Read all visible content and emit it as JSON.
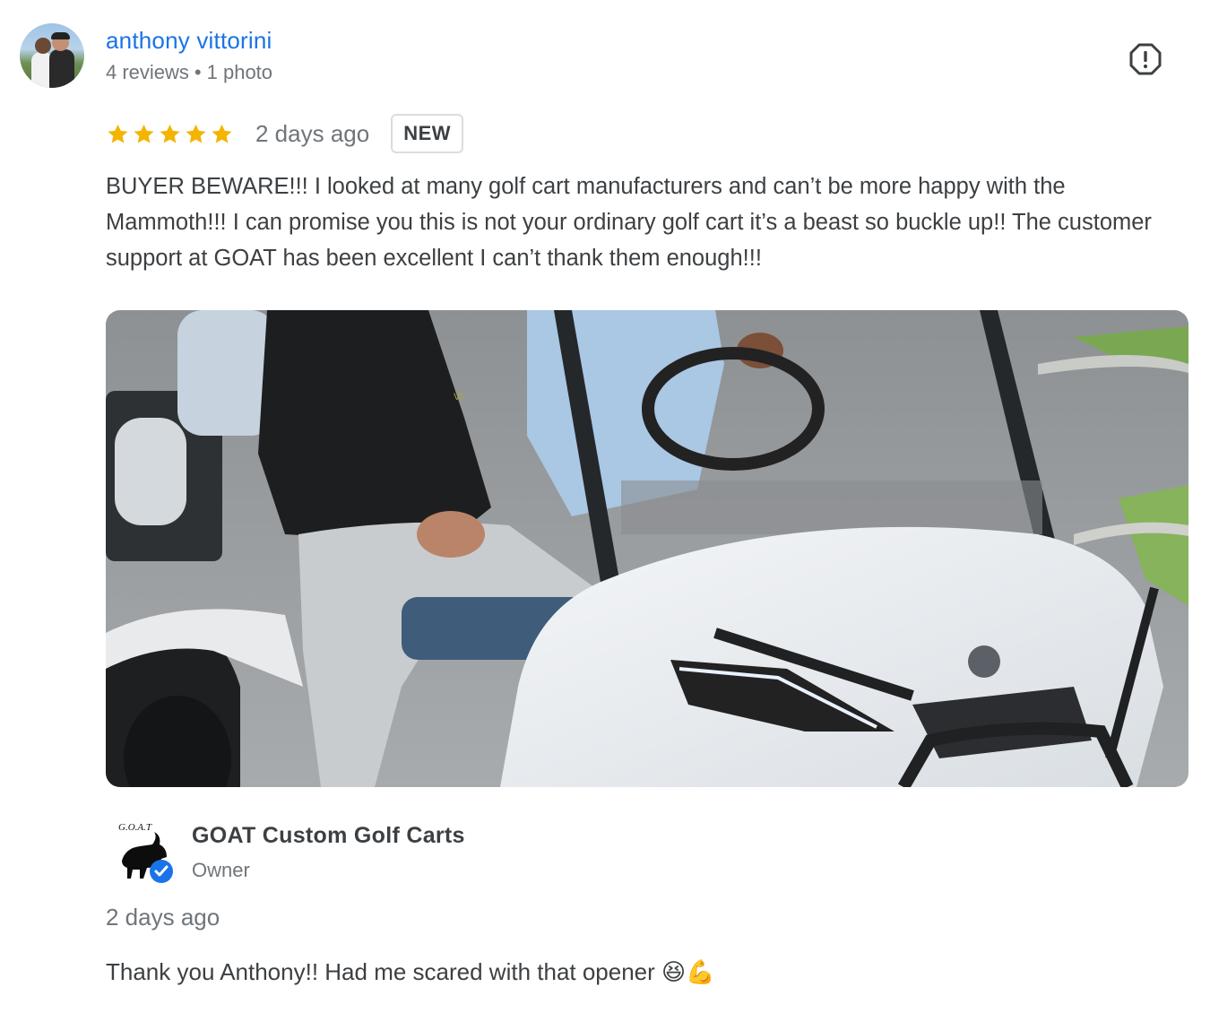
{
  "review": {
    "reviewer_name": "anthony vittorini",
    "reviewer_reviews": "4 reviews",
    "reviewer_dot": "•",
    "reviewer_photos": "1 photo",
    "rating": 5,
    "rating_max": 5,
    "time_ago": "2 days ago",
    "badge": "NEW",
    "text": "BUYER BEWARE!!! I looked at many golf cart manufacturers and can’t be more happy with the Mammoth!!! I can promise you this is not your ordinary golf cart it’s a beast so buckle up!! The customer support at GOAT has been excellent I can’t thank them enough!!!",
    "star_color": "#f4b400",
    "name_color": "#1a73e8"
  },
  "photo": {
    "alt": "Review photo"
  },
  "reply": {
    "owner_name": "GOAT Custom Golf Carts",
    "owner_role": "Owner",
    "time_ago": "2 days ago",
    "text": "Thank you Anthony!! Had me scared with that opener 😆💪",
    "logo_text": "G.O.A.T",
    "verified_color": "#1a73e8"
  },
  "icons": {
    "flag": "flag-report-icon",
    "verified": "verified-check-icon",
    "star": "star-icon"
  }
}
